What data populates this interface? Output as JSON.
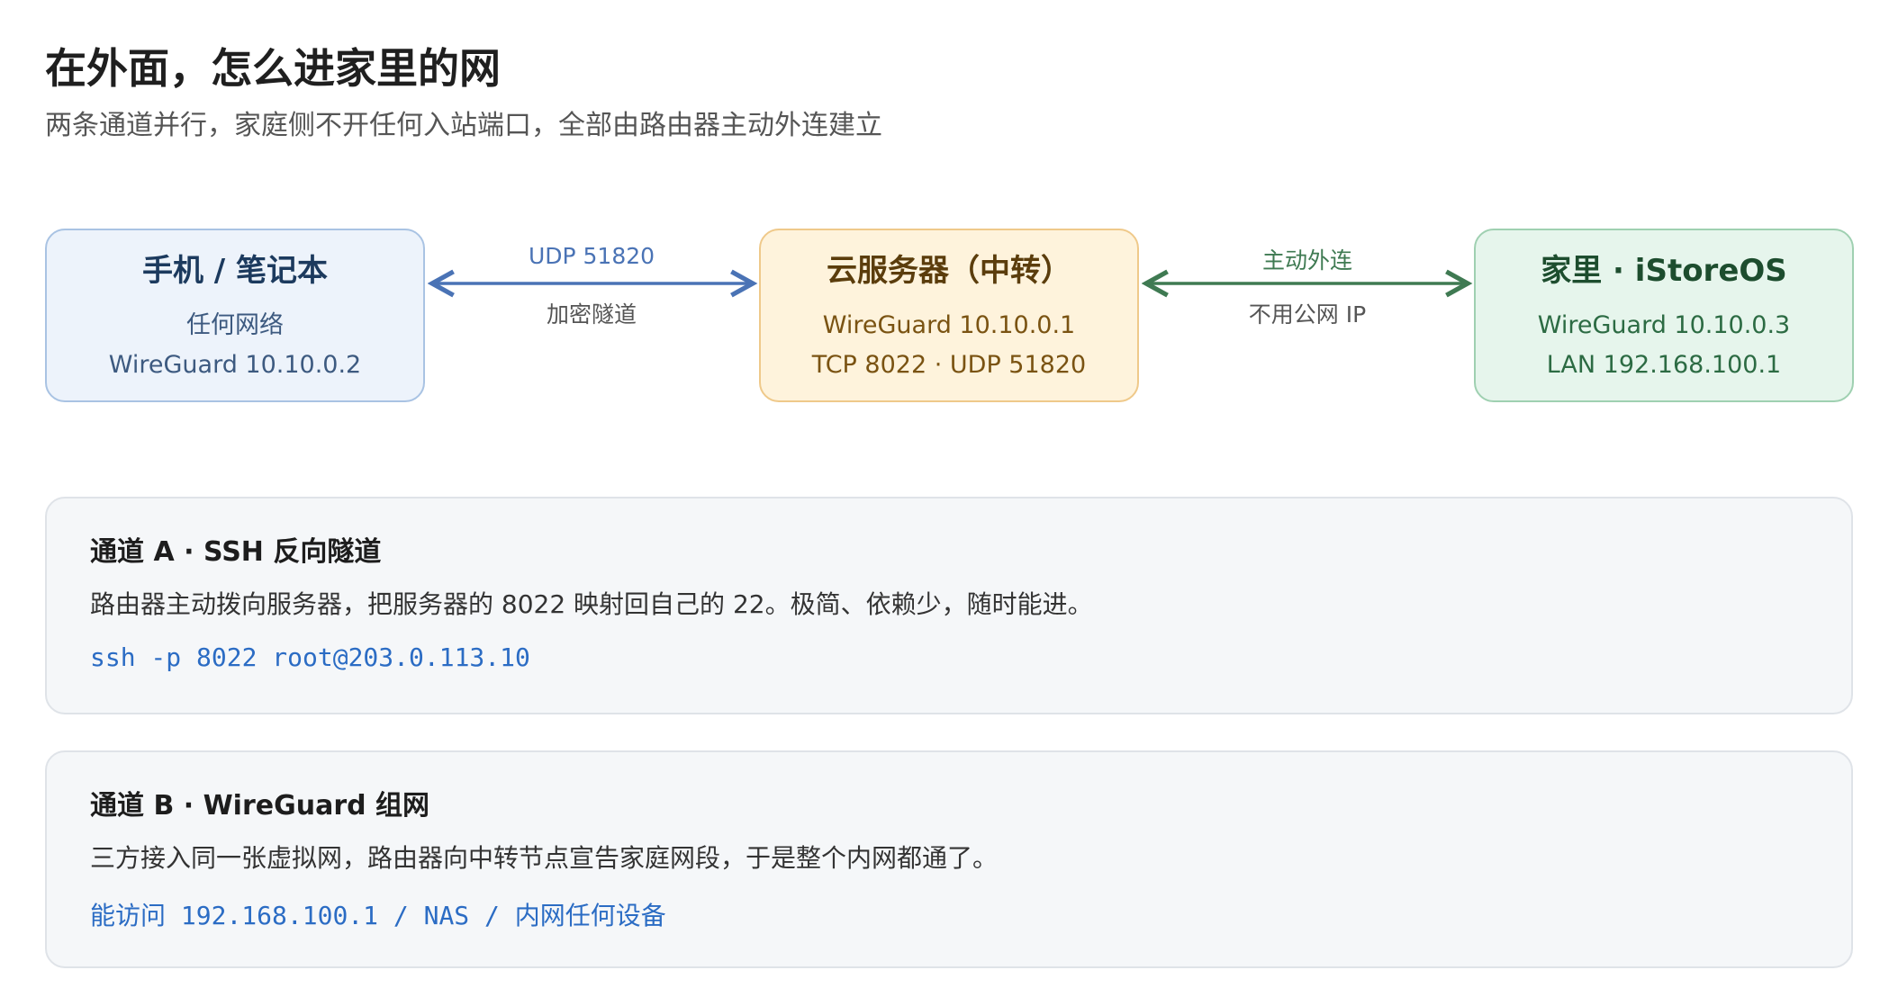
{
  "header": {
    "title": "在外面，怎么进家里的网",
    "subtitle": "两条通道并行，家庭侧不开任何入站端口，全部由路由器主动外连建立"
  },
  "nodes": {
    "client": {
      "title": "手机 / 笔记本",
      "line1": "任何网络",
      "line2": "WireGuard 10.10.0.2"
    },
    "relay": {
      "title": "云服务器（中转）",
      "line1": "WireGuard 10.10.0.1",
      "line2": "TCP 8022 · UDP 51820"
    },
    "home": {
      "title": "家里 · iStoreOS",
      "line1": "WireGuard 10.10.0.3",
      "line2": "LAN 192.168.100.1"
    }
  },
  "edges": {
    "client_relay": {
      "top_label": "UDP 51820",
      "bottom_label": "加密隧道",
      "color": "#4a73b5"
    },
    "relay_home": {
      "top_label": "主动外连",
      "bottom_label": "不用公网 IP",
      "color": "#3f7a52"
    }
  },
  "channels": {
    "a": {
      "title": "通道 A · SSH 反向隧道",
      "desc": "路由器主动拨向服务器，把服务器的 8022 映射回自己的 22。极简、依赖少，随时能进。",
      "code": "ssh -p 8022 root@203.0.113.10"
    },
    "b": {
      "title": "通道 B · WireGuard 组网",
      "desc": "三方接入同一张虚拟网，路由器向中转节点宣告家庭网段，于是整个内网都通了。",
      "code_prefix": "能访问",
      "code_main": "192.168.100.1 / NAS /",
      "code_suffix": "内网任何设备"
    }
  },
  "colors": {
    "accent_code": "#2b6cc4",
    "client_bg": "#edf3fb",
    "relay_bg": "#fef3dc",
    "home_bg": "#e6f5ec"
  }
}
